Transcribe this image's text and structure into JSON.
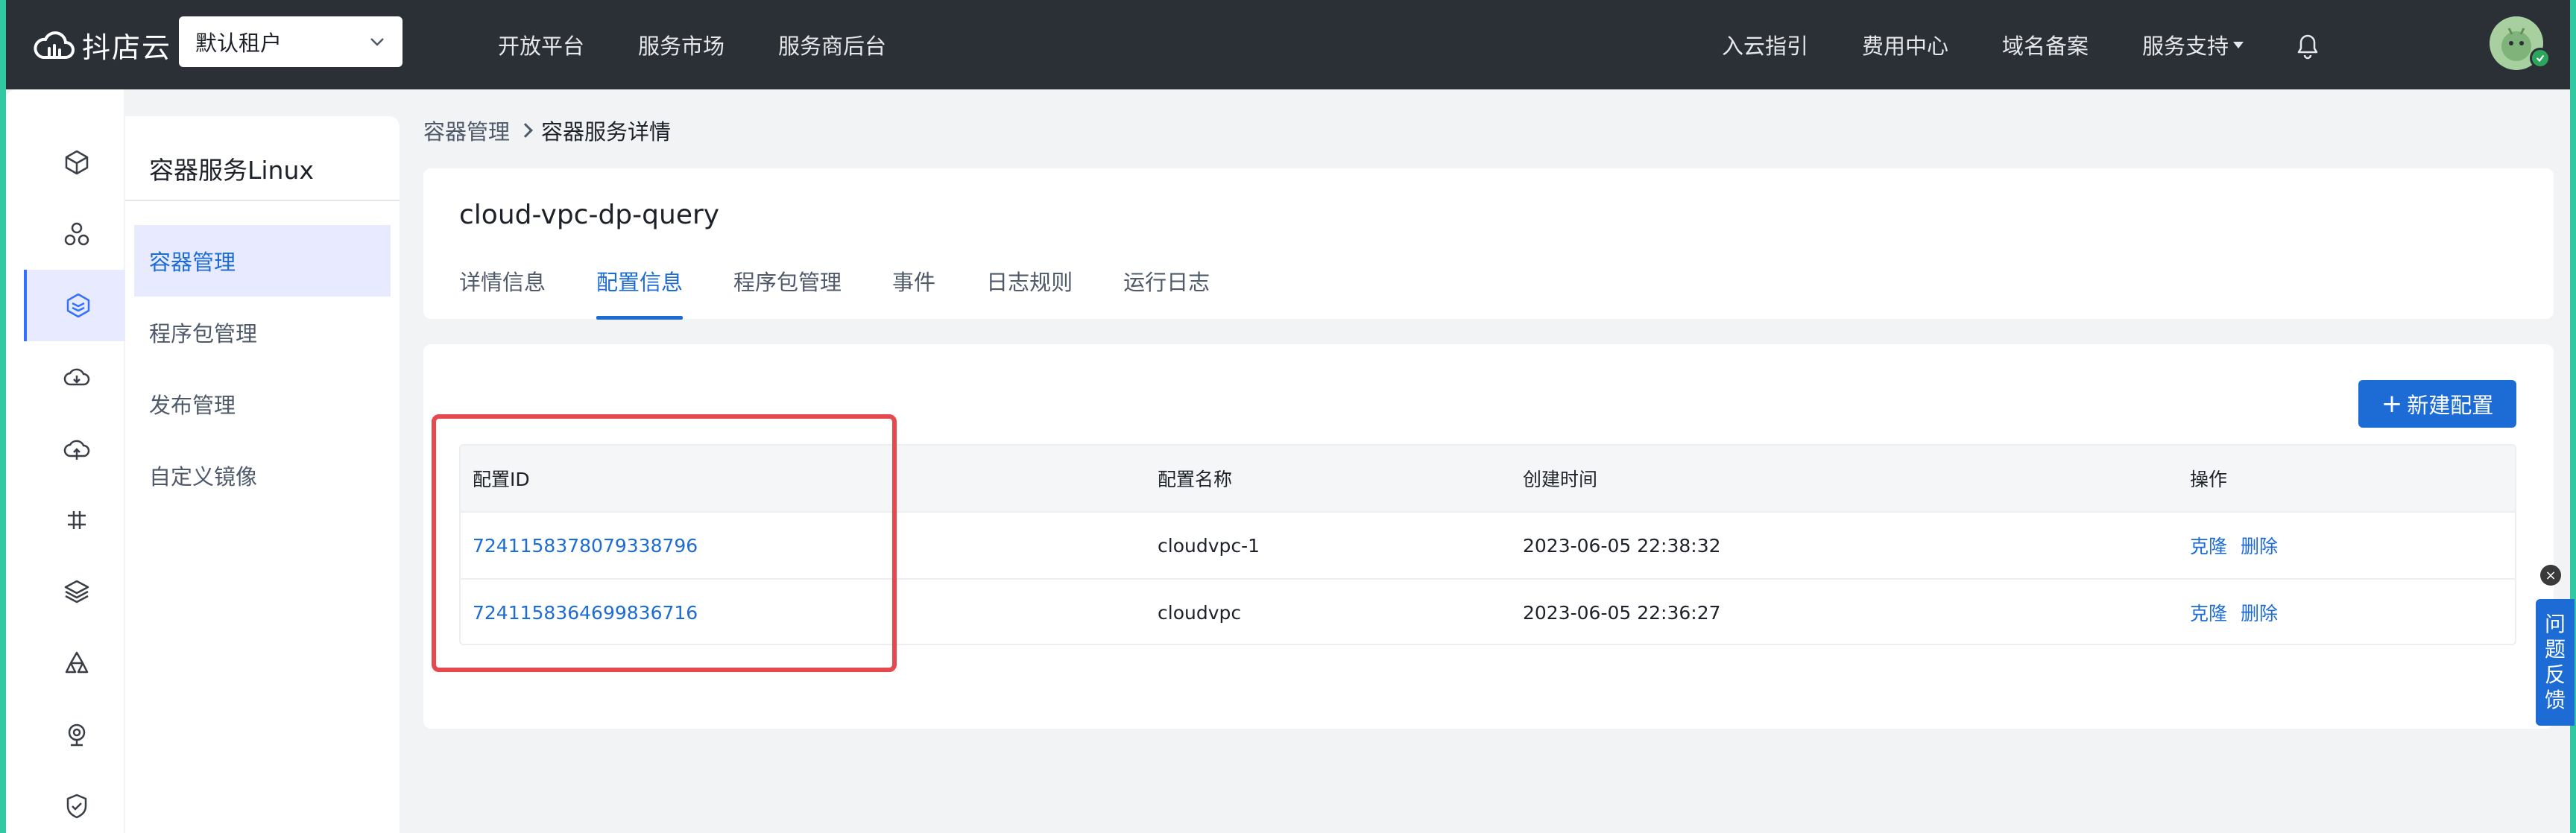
{
  "brand": {
    "name": "抖店云"
  },
  "tenant": {
    "selected": "默认租户"
  },
  "topnav": {
    "left": [
      "开放平台",
      "服务市场",
      "服务商后台"
    ],
    "right": [
      "入云指引",
      "费用中心",
      "域名备案",
      "服务支持"
    ]
  },
  "rail": {
    "icons": [
      "cube-icon",
      "molecule-icon",
      "container-icon",
      "cloud-download-icon",
      "cloud-upload-icon",
      "network-icon",
      "layers-icon",
      "cluster-icon",
      "camera-icon",
      "shield-icon"
    ],
    "active_index": 2
  },
  "sidebar": {
    "title": "容器服务Linux",
    "items": [
      "容器管理",
      "程序包管理",
      "发布管理",
      "自定义镜像"
    ],
    "active_index": 0
  },
  "breadcrumb": {
    "parent": "容器管理",
    "current": "容器服务详情"
  },
  "app": {
    "name": "cloud-vpc-dp-query",
    "tabs": [
      "详情信息",
      "配置信息",
      "程序包管理",
      "事件",
      "日志规则",
      "运行日志"
    ],
    "active_tab": 1
  },
  "toolbar": {
    "new_config_label": "新建配置"
  },
  "table": {
    "headers": [
      "配置ID",
      "配置名称",
      "创建时间",
      "操作"
    ],
    "rows": [
      {
        "id": "7241158378079338796",
        "name": "cloudvpc-1",
        "created": "2023-06-05 22:38:32",
        "clone": "克隆",
        "delete": "删除"
      },
      {
        "id": "7241158364699836716",
        "name": "cloudvpc",
        "created": "2023-06-05 22:36:27",
        "clone": "克隆",
        "delete": "删除"
      }
    ]
  },
  "feedback": {
    "chars": [
      "问",
      "题",
      "反",
      "馈"
    ],
    "close": "×"
  },
  "colors": {
    "topbar": "#2b2f36",
    "accent": "#1d6cd6",
    "highlight": "#e5484d",
    "frame": "#30c9a2"
  }
}
